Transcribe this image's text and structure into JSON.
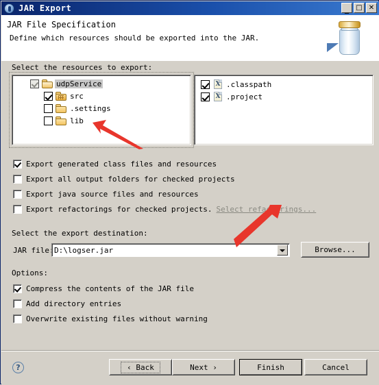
{
  "window": {
    "title": "JAR Export",
    "icon": "jar-export-icon",
    "controls": [
      {
        "name": "minimize-button",
        "glyph": "_"
      },
      {
        "name": "maximize-button",
        "glyph": "□"
      },
      {
        "name": "close-button",
        "glyph": "✕"
      }
    ]
  },
  "header": {
    "title": "JAR File Specification",
    "subtitle": "Define which resources should be exported into the JAR.",
    "icon": "jar-bottle-icon"
  },
  "resources": {
    "label": "Select the resources to export:",
    "tree": [
      {
        "label": "udpService",
        "checked": "grayed",
        "icon": "open-folder-icon",
        "indent": 0,
        "selected": true
      },
      {
        "label": "src",
        "checked": "checked",
        "icon": "source-folder-icon",
        "indent": 1,
        "selected": false
      },
      {
        "label": ".settings",
        "checked": "unchecked",
        "icon": "folder-icon",
        "indent": 1,
        "selected": false
      },
      {
        "label": "lib",
        "checked": "unchecked",
        "icon": "folder-icon",
        "indent": 1,
        "selected": false
      }
    ],
    "files": [
      {
        "label": ".classpath",
        "checked": "checked",
        "icon": "xml-file-icon"
      },
      {
        "label": ".project",
        "checked": "checked",
        "icon": "xml-file-icon"
      }
    ]
  },
  "export_options": [
    {
      "label": "Export generated class files and resources",
      "checked": true
    },
    {
      "label": "Export all output folders for checked projects",
      "checked": false
    },
    {
      "label": "Export java source files and resources",
      "checked": false
    },
    {
      "label": "Export refactorings for checked projects.",
      "checked": false,
      "link": "Select refactorings..."
    }
  ],
  "destination": {
    "label": "Select the export destination:",
    "field_label": "JAR file:",
    "value": "D:\\logser.jar",
    "placeholder": "",
    "browse_label": "Browse..."
  },
  "options": {
    "label": "Options:",
    "items": [
      {
        "label": "Compress the contents of the JAR file",
        "checked": true
      },
      {
        "label": "Add directory entries",
        "checked": false
      },
      {
        "label": "Overwrite existing files without warning",
        "checked": false
      }
    ]
  },
  "footer": {
    "help": "?",
    "back": "‹ Back",
    "next": "Next ›",
    "finish": "Finish",
    "cancel": "Cancel"
  },
  "colors": {
    "dialog_background": "#d4d0c8",
    "title_start": "#0a246a",
    "title_end": "#3a7ad0",
    "field_background": "#ffffff",
    "annotation_arrow": "#e8362c",
    "disabled_link": "#8a8a82"
  }
}
